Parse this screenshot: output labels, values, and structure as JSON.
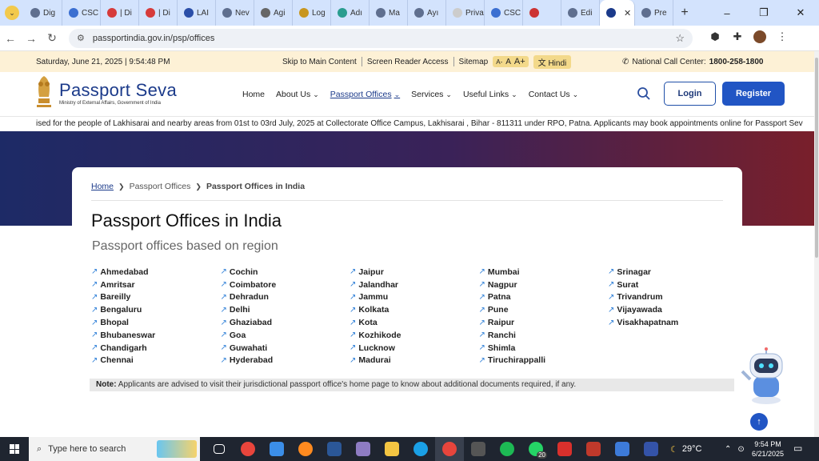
{
  "browser": {
    "tabs": [
      {
        "label": "Dig",
        "color": "#5f6f8f"
      },
      {
        "label": "CSC",
        "color": "#3b6fd1"
      },
      {
        "label": "| Di",
        "color": "#d63b3b"
      },
      {
        "label": "| Di",
        "color": "#d63b3b"
      },
      {
        "label": "LAI",
        "color": "#2a4ea8"
      },
      {
        "label": "Nev",
        "color": "#5f6f8f"
      },
      {
        "label": "Agi",
        "color": "#666666"
      },
      {
        "label": "Log",
        "color": "#c8961e"
      },
      {
        "label": "Adı",
        "color": "#2a9d8f"
      },
      {
        "label": "Ma",
        "color": "#5f6f8f"
      },
      {
        "label": "Ayı",
        "color": "#5f6f8f"
      },
      {
        "label": "Privacy",
        "color": "#cccccc"
      },
      {
        "label": "CSC",
        "color": "#3b6fd1"
      },
      {
        "label": "",
        "color": "#cc3333"
      },
      {
        "label": "Edi",
        "color": "#5f6f8f"
      },
      {
        "label": "",
        "color": "#1b3a8a"
      },
      {
        "label": "Pre",
        "color": "#5f6f8f"
      }
    ],
    "url": "passportindia.gov.in/psp/offices"
  },
  "topbar": {
    "date": "Saturday, June 21, 2025 | 9:54:48 PM",
    "skip": "Skip to Main Content",
    "reader": "Screen Reader Access",
    "sitemap": "Sitemap",
    "font_small": "A-",
    "font_mid": "A",
    "font_large": "A+",
    "hindi": "Hindi",
    "call_label": "National Call Center:",
    "call_number": "1800-258-1800"
  },
  "header": {
    "brand_name": "Passport Seva",
    "brand_sub": "Ministry of External Affairs, Government of India",
    "nav": [
      {
        "label": "Home",
        "dropdown": false
      },
      {
        "label": "About Us",
        "dropdown": true
      },
      {
        "label": "Passport Offices",
        "dropdown": true
      },
      {
        "label": "Services",
        "dropdown": true
      },
      {
        "label": "Useful Links",
        "dropdown": true
      },
      {
        "label": "Contact Us",
        "dropdown": true
      }
    ],
    "login": "Login",
    "register": "Register"
  },
  "marquee": "ised for the people of Lakhisarai and nearby areas from 01st to 03rd July, 2025 at Collectorate Office Campus, Lakhisarai , Bihar - 811311 under RPO, Patna. Applicants may book appointments online for Passport Sev",
  "breadcrumb": {
    "home": "Home",
    "parent": "Passport Offices",
    "current": "Passport Offices in India"
  },
  "page_title": "Passport Offices in India",
  "subtitle": "Passport offices based on region",
  "offices": [
    [
      "Ahmedabad",
      "Amritsar",
      "Bareilly",
      "Bengaluru",
      "Bhopal",
      "Bhubaneswar",
      "Chandigarh",
      "Chennai"
    ],
    [
      "Cochin",
      "Coimbatore",
      "Dehradun",
      "Delhi",
      "Ghaziabad",
      "Goa",
      "Guwahati",
      "Hyderabad"
    ],
    [
      "Jaipur",
      "Jalandhar",
      "Jammu",
      "Kolkata",
      "Kota",
      "Kozhikode",
      "Lucknow",
      "Madurai"
    ],
    [
      "Mumbai",
      "Nagpur",
      "Patna",
      "Pune",
      "Raipur",
      "Ranchi",
      "Shimla",
      "Tiruchirappalli"
    ],
    [
      "Srinagar",
      "Surat",
      "Trivandrum",
      "Vijayawada",
      "Visakhapatnam"
    ]
  ],
  "note": {
    "label": "Note:",
    "text": "Applicants are advised to visit their jurisdictional passport office's home page to know about additional documents required, if any."
  },
  "taskbar": {
    "search_placeholder": "Type here to search",
    "whatsapp_badge": "20",
    "temperature": "29°C",
    "time": "9:54 PM",
    "date": "6/21/2025",
    "apps": [
      {
        "name": "task-view",
        "color": "#ffffff"
      },
      {
        "name": "chrome",
        "color": "#e8453c"
      },
      {
        "name": "store",
        "color": "#3b8ee8"
      },
      {
        "name": "firefox",
        "color": "#ff8a1f"
      },
      {
        "name": "word",
        "color": "#2b5797"
      },
      {
        "name": "widgets",
        "color": "#8e7cc3"
      },
      {
        "name": "explorer",
        "color": "#f4c542"
      },
      {
        "name": "edge",
        "color": "#1aa0e6"
      },
      {
        "name": "chrome-active",
        "color": "#e8453c"
      },
      {
        "name": "app-d",
        "color": "#555555"
      },
      {
        "name": "spotify",
        "color": "#1db954"
      },
      {
        "name": "whatsapp",
        "color": "#25d366"
      },
      {
        "name": "acrobat",
        "color": "#d9302c"
      },
      {
        "name": "app-red",
        "color": "#c0392b"
      },
      {
        "name": "app-shield",
        "color": "#3d7bd9"
      },
      {
        "name": "app-blue",
        "color": "#3453a8"
      }
    ]
  }
}
